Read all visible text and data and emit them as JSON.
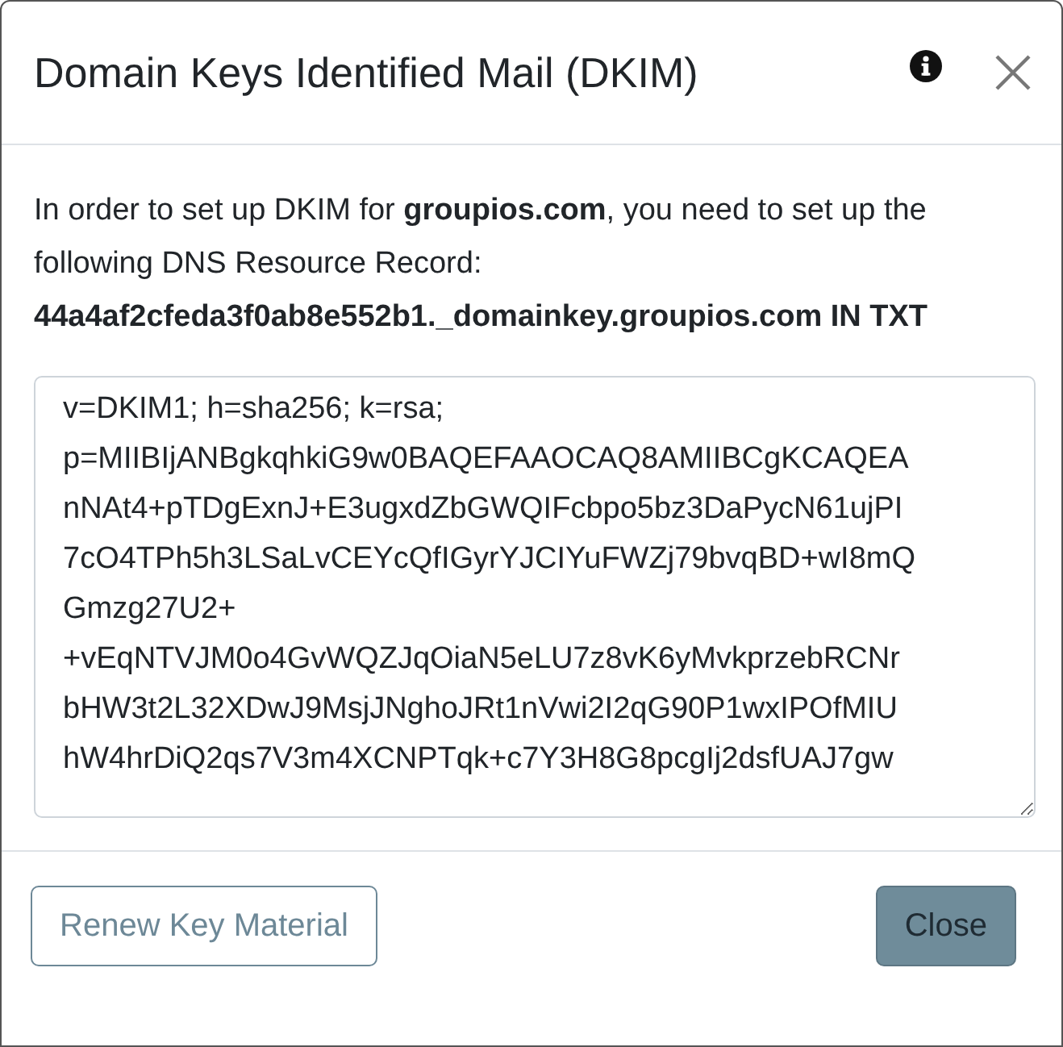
{
  "dialog": {
    "title": "Domain Keys Identified Mail (DKIM)",
    "intro": "In order to set up DKIM for **groupios.com**, you need to set up the following DNS Resource Record:",
    "record": "44a4af2cfeda3f0ab8e552b1._domainkey.groupios.com IN TXT",
    "record_value": [
      "v=DKIM1; h=sha256; k=rsa;",
      "p=MIIBIjANBgkqhkiG9w0BAQEFAAOCAQ8AMIIBCgKCAQEA",
      "nNAt4+pTDgExnJ+E3ugxdZbGWQIFcbpo5bz3DaPycN61ujPI",
      "7cO4TPh5h3LSaLvCEYcQfIGyrYJCIYuFWZj79bvqBD+wI8mQ",
      "Gmzg27U2+",
      "+vEqNTVJM0o4GvWQZJqOiaN5eLU7z8vK6yMvkprzebRCNr",
      "bHW3t2L32XDwJ9MsjJNghoJRt1nVwi2I2qG90P1wxIPOfMIU",
      "hW4hrDiQ2qs7V3m4XCNPTqk+c7Y3H8G8pcgIj2dsfUAJ7gw"
    ],
    "buttons": [
      {
        "label": "Renew Key Material",
        "kind": "outline"
      },
      {
        "label": "Close",
        "kind": "primary"
      }
    ]
  }
}
